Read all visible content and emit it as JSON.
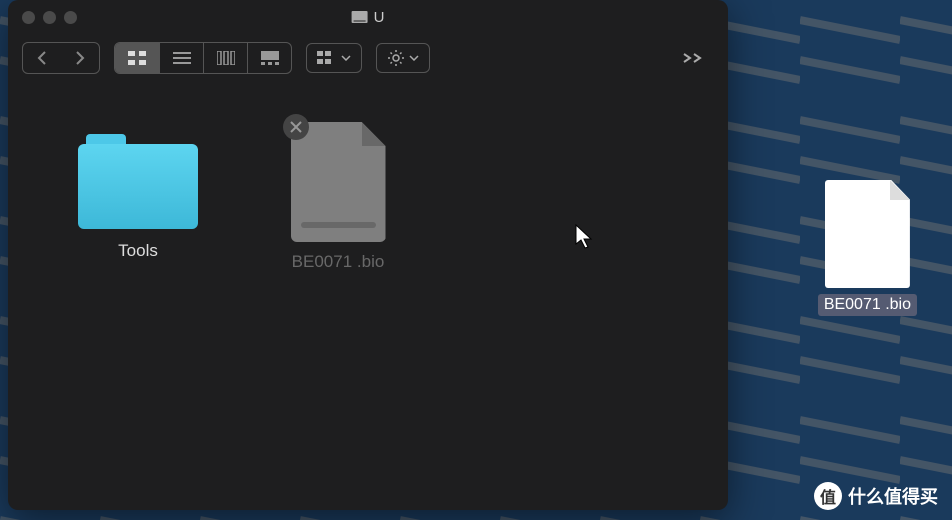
{
  "window": {
    "title": "U",
    "disk_icon": "disk-icon"
  },
  "toolbar": {
    "back": "‹",
    "forward": "›",
    "view_icon": "icon",
    "view_list": "list",
    "view_column": "column",
    "view_gallery": "gallery",
    "group": "group",
    "action": "gear",
    "more": "more"
  },
  "items": [
    {
      "name": "Tools",
      "type": "folder"
    },
    {
      "name": "BE0071 .bio",
      "type": "file",
      "dragging": true
    }
  ],
  "desktop_file": {
    "name": "BE0071 .bio"
  },
  "watermark": {
    "badge": "值",
    "text": "什么值得买"
  }
}
